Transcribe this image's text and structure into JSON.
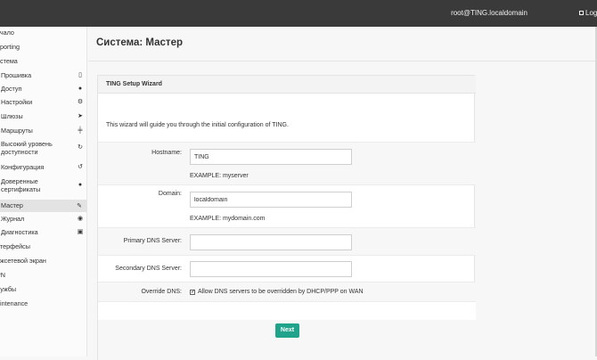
{
  "topbar": {
    "user": "root@TING.localdomain",
    "logout": "Logout"
  },
  "sidebar": {
    "items": [
      {
        "label": "Начало",
        "display": "ачало"
      },
      {
        "label": "Reporting",
        "display": "eporting"
      },
      {
        "label": "Система",
        "display": "истема"
      },
      {
        "label": "Прошивка",
        "display": "Прошивка",
        "icon": "phone-icon"
      },
      {
        "label": "Доступ",
        "display": "Доступ",
        "icon": "users-icon"
      },
      {
        "label": "Настройки",
        "display": "Настройки",
        "icon": "cogs-icon"
      },
      {
        "label": "Шлюзы",
        "display": "Шлюзы",
        "icon": "location-arrow-icon"
      },
      {
        "label": "Маршруты",
        "display": "Маршруты",
        "icon": "signpost-icon"
      },
      {
        "label": "Высокий уровень доступности",
        "display_line1": "Высокий уровень",
        "display_line2": "доступности",
        "icon": "refresh-icon"
      },
      {
        "label": "Конфигурация",
        "display": "Конфигурация",
        "icon": "history-icon"
      },
      {
        "label": "Доверенные сертификаты",
        "display_line1": "Доверенные",
        "display_line2": "сертификаты",
        "icon": "certificate-icon"
      },
      {
        "label": "Мастер",
        "display": "Мастер",
        "icon": "magic-icon",
        "active": true
      },
      {
        "label": "Журнал",
        "display": "Журнал",
        "icon": "eye-icon"
      },
      {
        "label": "Диагностика",
        "display": "Диагностика",
        "icon": "medkit-icon"
      },
      {
        "label": "Интерфейсы",
        "display": "нтерфейсы"
      },
      {
        "label": "Межсетевой экран",
        "display": "ежсетевой экран"
      },
      {
        "label": "VPN",
        "display": "PN"
      },
      {
        "label": "Службы",
        "display": "лужбы"
      },
      {
        "label": "Maintenance",
        "display": "aintenance"
      }
    ]
  },
  "page": {
    "title": "Система: Мастер"
  },
  "wizard": {
    "header": "TING Setup Wizard",
    "intro": "This wizard will guide you through the initial configuration of TING.",
    "hostname_label": "Hostname:",
    "hostname_value": "TING",
    "hostname_hint": "EXAMPLE: myserver",
    "domain_label": "Domain:",
    "domain_value": "localdomain",
    "domain_hint": "EXAMPLE: mydomain.com",
    "primary_dns_label": "Primary DNS Server:",
    "primary_dns_value": "",
    "secondary_dns_label": "Secondary DNS Server:",
    "secondary_dns_value": "",
    "override_dns_label": "Override DNS:",
    "override_dns_checked": true,
    "override_dns_text": "Allow DNS servers to be overridden by DHCP/PPP on WAN",
    "next_label": "Next"
  },
  "colors": {
    "topbar": "#3a3a3a",
    "accent": "#1fa38a",
    "active_item": "#e3e3e3"
  }
}
